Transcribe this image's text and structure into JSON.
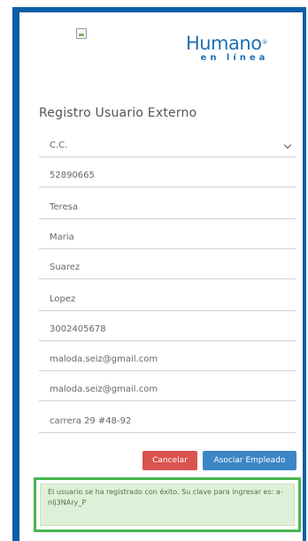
{
  "logo": {
    "main": "Humano",
    "reg_mark": "®",
    "sub": "en línea"
  },
  "form": {
    "title": "Registro Usuario Externo",
    "fields": [
      {
        "name": "document-type-select",
        "value": "C.C."
      },
      {
        "name": "document-number-field",
        "value": "52890665"
      },
      {
        "name": "first-name-field",
        "value": "Teresa"
      },
      {
        "name": "middle-name-field",
        "value": "Maria"
      },
      {
        "name": "first-surname-field",
        "value": "Suarez"
      },
      {
        "name": "second-surname-field",
        "value": "Lopez"
      },
      {
        "name": "phone-field",
        "value": "3002405678"
      },
      {
        "name": "email-field",
        "value": "maloda.seiz@gmail.com"
      },
      {
        "name": "email-confirm-field",
        "value": "maloda.seiz@gmail.com"
      },
      {
        "name": "address-field",
        "value": "carrera 29 #48-92"
      }
    ]
  },
  "buttons": {
    "cancel": "Cancelar",
    "associate": "Asociar Empleado"
  },
  "alert": {
    "message": "El usuario se ha registrado con éxito. Su clave para ingresar es: a-nIj3NAry_P"
  },
  "colors": {
    "brand_blue": "#1f6fb5",
    "cancel_red": "#d9534f",
    "associate_blue": "#3c86c6",
    "success_green": "#47b54d"
  }
}
